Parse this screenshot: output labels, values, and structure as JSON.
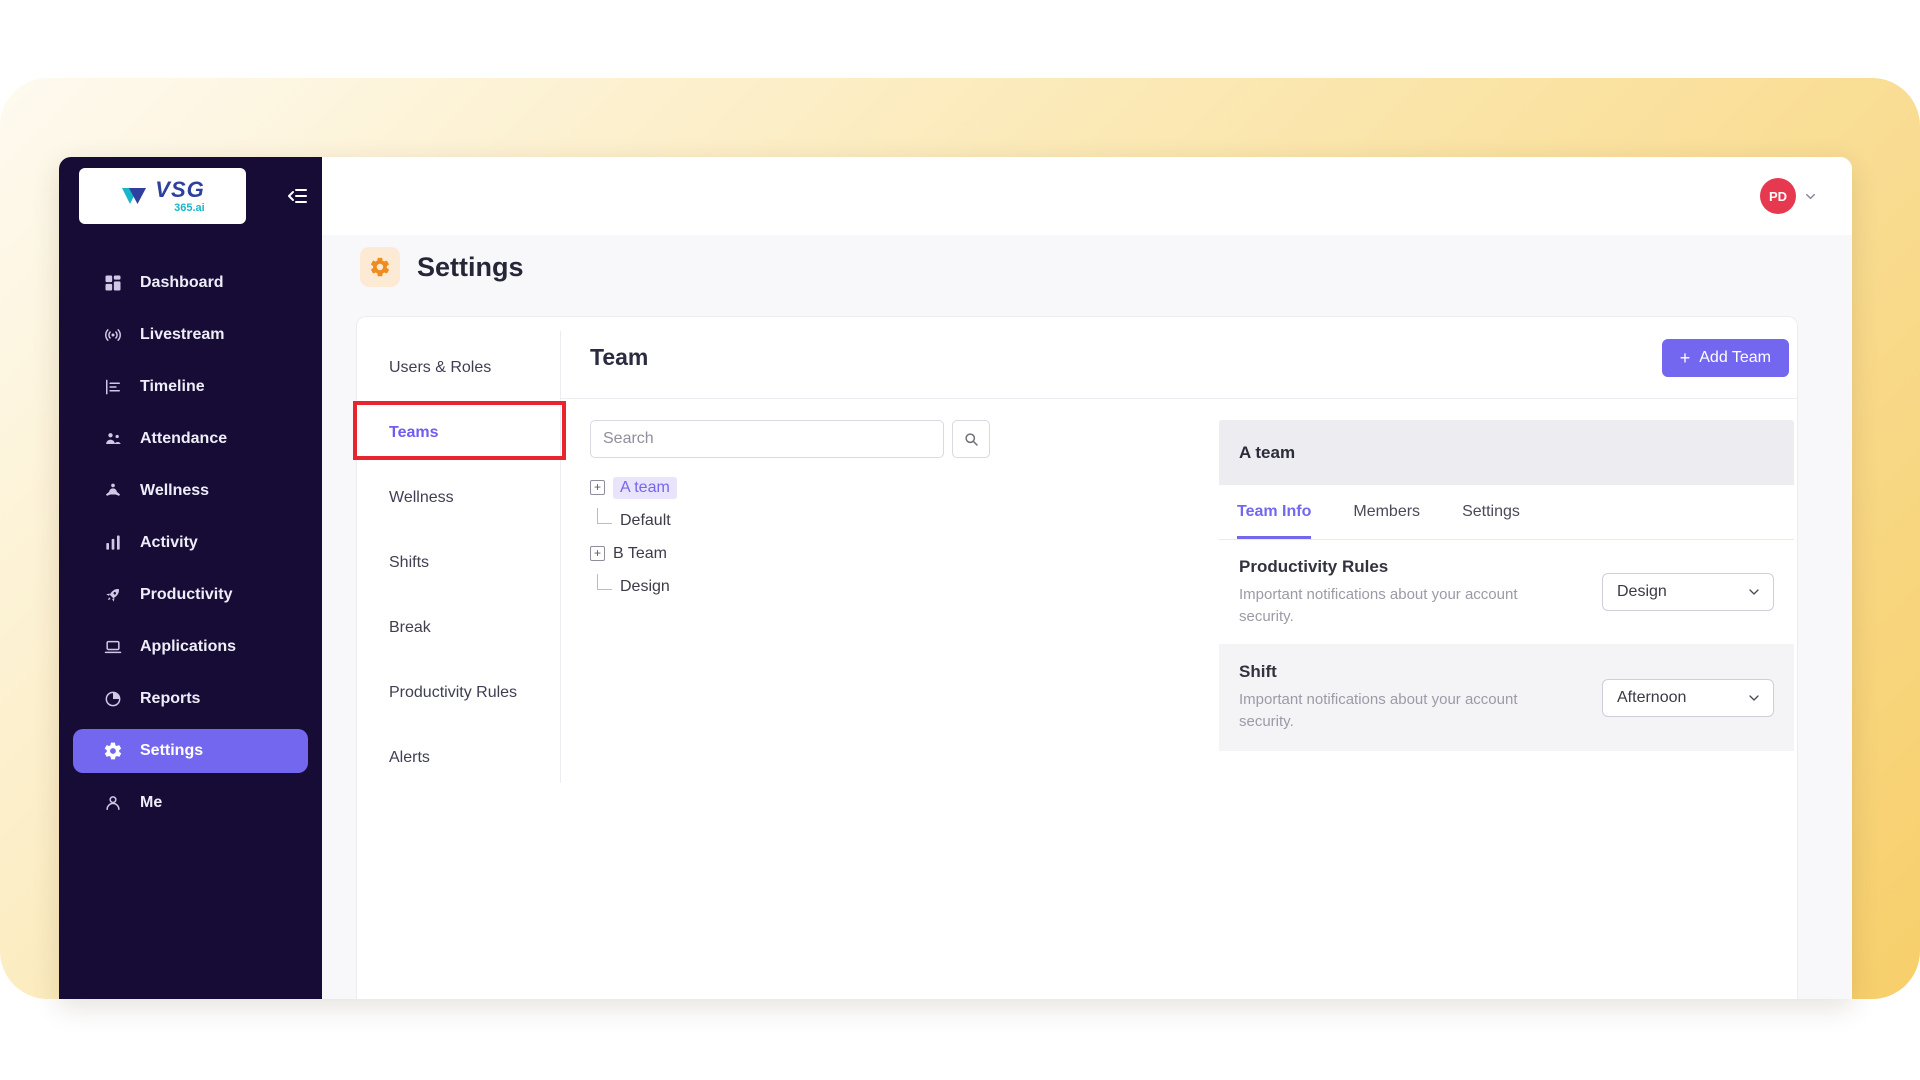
{
  "app": {
    "logo": {
      "text": "VSG",
      "sub": "365.ai"
    }
  },
  "topbar": {
    "avatar": "PD"
  },
  "sidebar": {
    "items": [
      {
        "label": "Dashboard"
      },
      {
        "label": "Livestream"
      },
      {
        "label": "Timeline"
      },
      {
        "label": "Attendance"
      },
      {
        "label": "Wellness"
      },
      {
        "label": "Activity"
      },
      {
        "label": "Productivity"
      },
      {
        "label": "Applications"
      },
      {
        "label": "Reports"
      },
      {
        "label": "Settings"
      },
      {
        "label": "Me"
      }
    ],
    "active": "Settings"
  },
  "page": {
    "title": "Settings"
  },
  "settings_nav": {
    "items": [
      {
        "label": "Users & Roles"
      },
      {
        "label": "Teams"
      },
      {
        "label": "Wellness"
      },
      {
        "label": "Shifts"
      },
      {
        "label": "Break"
      },
      {
        "label": "Productivity Rules"
      },
      {
        "label": "Alerts"
      }
    ],
    "active": "Teams"
  },
  "team": {
    "heading": "Team",
    "add_button": "Add Team",
    "search_placeholder": "Search",
    "tree": [
      {
        "expander": "+",
        "label": "A team",
        "selected": true
      },
      {
        "label": "Default"
      },
      {
        "expander": "+",
        "label": "B Team"
      },
      {
        "label": "Design"
      }
    ]
  },
  "detail": {
    "title": "A team",
    "tabs": [
      {
        "label": "Team Info"
      },
      {
        "label": "Members"
      },
      {
        "label": "Settings"
      }
    ],
    "active_tab": "Team Info",
    "rows": [
      {
        "title": "Productivity Rules",
        "description": "Important notifications about your account security.",
        "value": "Design"
      },
      {
        "title": "Shift",
        "description": "Important notifications about your account security.",
        "value": "Afternoon"
      }
    ]
  },
  "icons": {
    "plus": "+"
  },
  "colors": {
    "accent": "#7367f0",
    "sidebar_bg": "#170c36",
    "avatar_red": "#e6394f",
    "annotation_red": "#e8252c",
    "gear_orange": "#ef8b1f"
  }
}
